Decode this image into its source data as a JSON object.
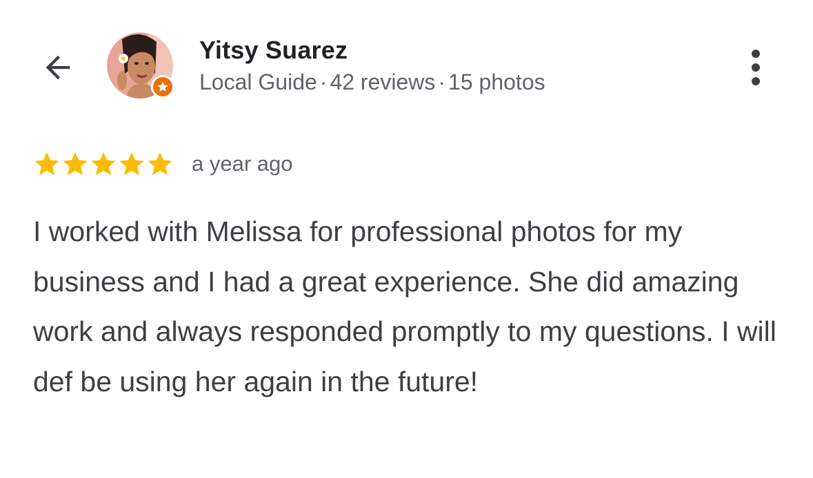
{
  "header": {
    "back_icon": "arrow-back-icon",
    "more_icon": "more-vert-icon"
  },
  "user": {
    "name": "Yitsy Suarez",
    "badge": "Local Guide",
    "reviews": "42 reviews",
    "photos": "15 photos",
    "separator": "·",
    "badge_icon": "local-guide-star-icon",
    "badge_color": "#e8710a"
  },
  "review": {
    "rating": 5,
    "max_rating": 5,
    "star_color": "#fbbc04",
    "time": "a year ago",
    "text": "I worked with Melissa for professional photos for my business and I had a great experience. She did amazing work and always responded promptly to my questions. I will def be using her again in the future!"
  }
}
